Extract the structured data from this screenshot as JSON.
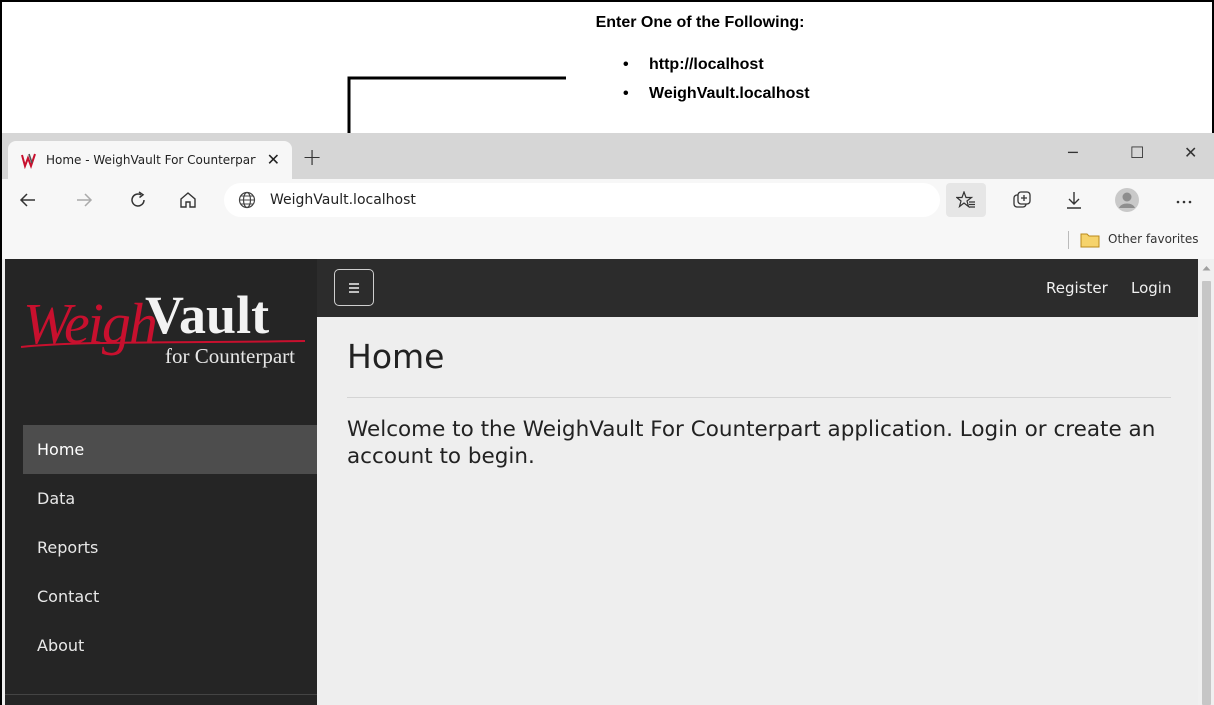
{
  "annotation": {
    "heading": "Enter One of the Following:",
    "options": [
      "http://localhost",
      "WeighVault.localhost"
    ],
    "bullet": "•"
  },
  "browser": {
    "tab_title": "Home - WeighVault For Counterpart",
    "tab_close": "✕",
    "new_tab": "+",
    "address": "WeighVault.localhost",
    "favorites_folder": "Other favorites",
    "window_minimize": "─",
    "window_maximize": "☐",
    "window_close": "✕"
  },
  "site": {
    "logo_primary": "WeighVault",
    "logo_secondary": "for Counterpart",
    "nav": [
      "Home",
      "Data",
      "Reports",
      "Contact",
      "About"
    ],
    "active_nav": "Home",
    "menu_icon": "hamburger-icon",
    "top_links": [
      "Register",
      "Login"
    ],
    "page_title": "Home",
    "welcome": "Welcome to the WeighVault For Counterpart application. Login or create an account to begin."
  },
  "colors": {
    "sidebar": "#252525",
    "active_nav": "#4d4d4d",
    "topbar": "#2c2c2c",
    "content_bg": "#eeeeee",
    "logo_red": "#c8102e"
  }
}
